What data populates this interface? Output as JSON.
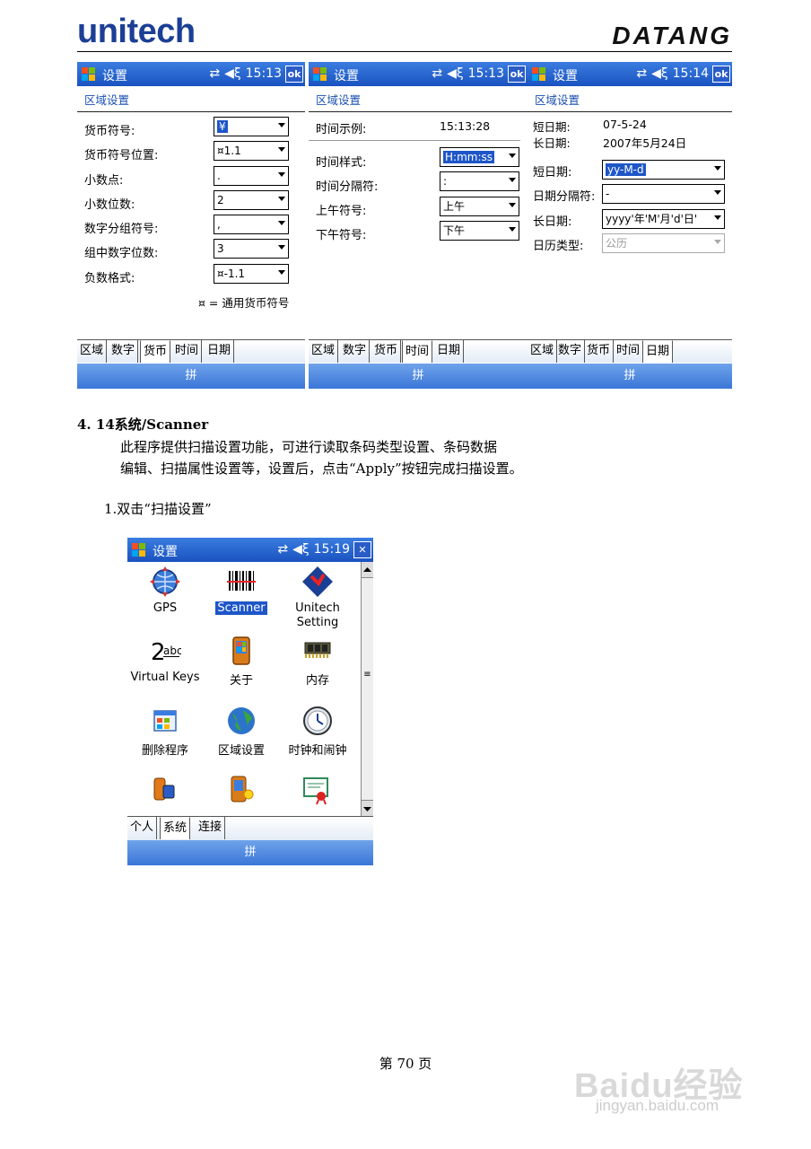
{
  "header": {
    "logo_left": "unitech",
    "logo_right": "DATANG"
  },
  "screens": [
    {
      "title": "设置",
      "time": "15:13",
      "ok": "ok",
      "subtitle": "区域设置",
      "rows": [
        {
          "label": "货币符号:",
          "value": "¥",
          "selected": true
        },
        {
          "label": "货币符号位置:",
          "value": "¤1.1"
        },
        {
          "label": "小数点:",
          "value": "."
        },
        {
          "label": "小数位数:",
          "value": "2"
        },
        {
          "label": "数字分组符号:",
          "value": ","
        },
        {
          "label": "组中数字位数:",
          "value": "3"
        },
        {
          "label": "负数格式:",
          "value": "¤-1.1"
        }
      ],
      "note": "¤ = 通用货币符号",
      "tabs": [
        "区域",
        "数字",
        "货币",
        "时间",
        "日期"
      ],
      "active_tab": 2,
      "menu": "拼"
    },
    {
      "title": "设置",
      "time": "15:13",
      "ok": "ok",
      "subtitle": "区域设置",
      "sample_label": "时间示例:",
      "sample_value": "15:13:28",
      "rows": [
        {
          "label": "时间样式:",
          "value": "H:mm:ss",
          "selected": true
        },
        {
          "label": "时间分隔符:",
          "value": ":"
        },
        {
          "label": "上午符号:",
          "value": "上午"
        },
        {
          "label": "下午符号:",
          "value": "下午"
        }
      ],
      "tabs": [
        "区域",
        "数字",
        "货币",
        "时间",
        "日期"
      ],
      "active_tab": 3,
      "menu": "拼"
    },
    {
      "title": "设置",
      "time": "15:14",
      "ok": "ok",
      "subtitle": "区域设置",
      "short_label": "短日期:",
      "short_value": "07-5-24",
      "long_label": "长日期:",
      "long_value": "2007年5月24日",
      "rows": [
        {
          "label": "短日期:",
          "value": "yy-M-d",
          "selected": true
        },
        {
          "label": "日期分隔符:",
          "value": "-"
        },
        {
          "label": "长日期:",
          "value": "yyyy'年'M'月'd'日'"
        },
        {
          "label": "日历类型:",
          "value": "公历",
          "disabled": true
        }
      ],
      "tabs": [
        "区域",
        "数字",
        "货币",
        "时间",
        "日期"
      ],
      "active_tab": 4,
      "menu": "拼"
    }
  ],
  "section": {
    "title": "4. 14系统/Scanner",
    "para1": "此程序提供扫描设置功能，可进行读取条码类型设置、条码数据",
    "para2": "编辑、扫描属性设置等，设置后，点击“Apply”按钮完成扫描设置。",
    "step1": "1.双击“扫描设置”"
  },
  "system_screen": {
    "title": "设置",
    "time": "15:19",
    "close": "✕",
    "icons": [
      {
        "name": "gps-icon",
        "label": "GPS"
      },
      {
        "name": "scanner-icon",
        "label": "Scanner",
        "selected": true
      },
      {
        "name": "unitech-setting-icon",
        "label": "Unitech Setting"
      },
      {
        "name": "virtual-keys-icon",
        "label": "Virtual Keys"
      },
      {
        "name": "about-icon",
        "label": "关于"
      },
      {
        "name": "memory-icon",
        "label": "内存"
      },
      {
        "name": "remove-programs-icon",
        "label": "删除程序"
      },
      {
        "name": "regional-settings-icon",
        "label": "区域设置"
      },
      {
        "name": "clock-alarm-icon",
        "label": "时钟和闹钟"
      }
    ],
    "tabs": [
      "个人",
      "系统",
      "连接"
    ],
    "active_tab": 1,
    "menu": "拼"
  },
  "footer": {
    "page": "第 70 页"
  },
  "watermark": {
    "main": "Baidu经验",
    "sub": "jingyan.baidu.com"
  },
  "colors": {
    "titlebar": "#1a52c0",
    "selection": "#1e56c8",
    "logo": "#1c3f95"
  }
}
